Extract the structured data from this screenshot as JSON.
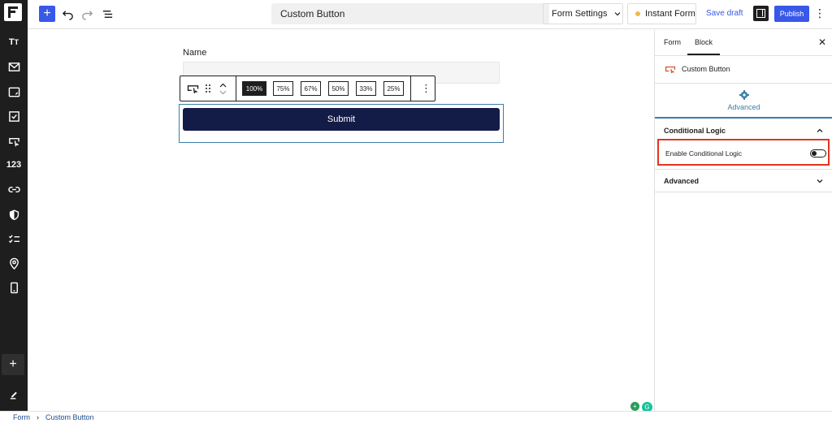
{
  "topbar": {
    "document_title": "Custom Button",
    "form_settings_label": "Form Settings",
    "instant_form_label": "Instant Form",
    "save_draft_label": "Save draft",
    "publish_label": "Publish"
  },
  "rail": {
    "number_label": "123"
  },
  "canvas": {
    "field_label": "Name",
    "submit_label": "Submit",
    "width_options": [
      "100%",
      "75%",
      "67%",
      "50%",
      "33%",
      "25%"
    ],
    "selected_width": "100%"
  },
  "sidebar": {
    "tabs": [
      {
        "label": "Form"
      },
      {
        "label": "Block"
      }
    ],
    "active_tab": "Block",
    "block_name": "Custom Button",
    "advanced_tab_label": "Advanced",
    "conditional_logic_title": "Conditional Logic",
    "enable_conditional_logic_label": "Enable Conditional Logic",
    "enable_conditional_logic_on": false,
    "advanced_section_title": "Advanced"
  },
  "breadcrumb": {
    "root": "Form",
    "current": "Custom Button"
  },
  "colors": {
    "accent": "#3858e9",
    "submit_bg": "#131c47",
    "highlight": "#e2351c",
    "block_frame": "#3a7eaa",
    "instant_dot": "#f0b849"
  }
}
